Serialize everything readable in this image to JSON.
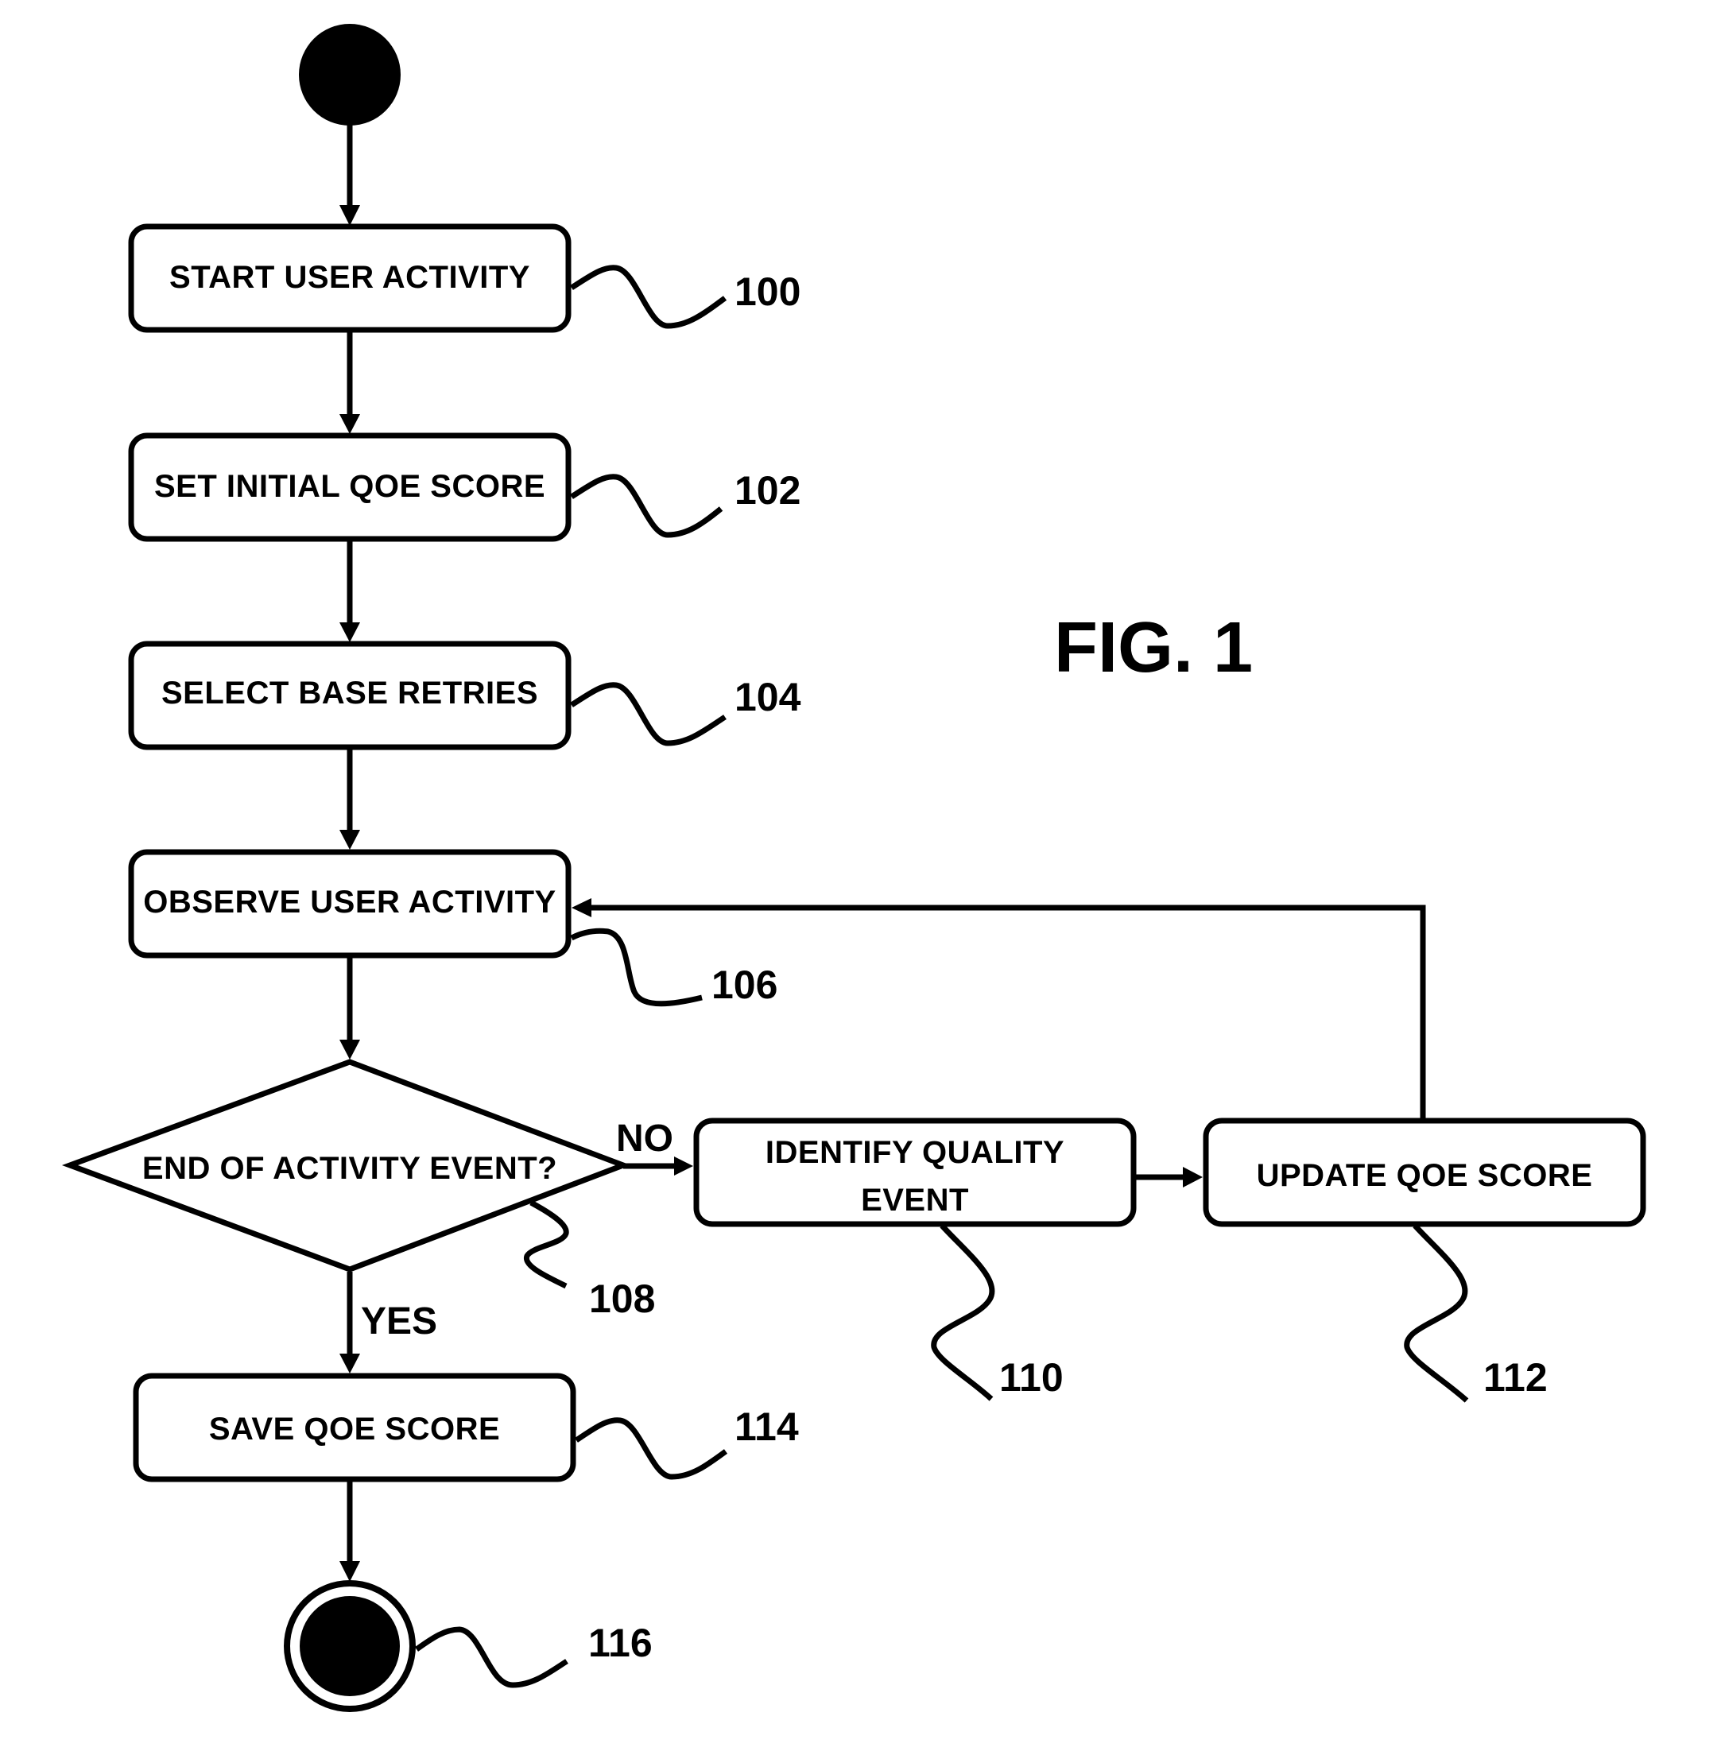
{
  "figure": {
    "title": "FIG. 1"
  },
  "nodes": {
    "start": {
      "type": "initial-node"
    },
    "start_user_activity": {
      "label": "START USER ACTIVITY",
      "ref": "100"
    },
    "set_initial_qoe_score": {
      "label": "SET INITIAL QOE SCORE",
      "ref": "102"
    },
    "select_base_retries": {
      "label": "SELECT BASE RETRIES",
      "ref": "104"
    },
    "observe_user_activity": {
      "label": "OBSERVE USER ACTIVITY",
      "ref": "106"
    },
    "end_of_activity_event": {
      "label": "END OF ACTIVITY EVENT?",
      "ref": "108"
    },
    "identify_quality_event": {
      "label_line1": "IDENTIFY QUALITY",
      "label_line2": "EVENT",
      "ref": "110"
    },
    "update_qoe_score": {
      "label": "UPDATE QOE SCORE",
      "ref": "112"
    },
    "save_qoe_score": {
      "label": "SAVE QOE SCORE",
      "ref": "114"
    },
    "end": {
      "type": "final-node",
      "ref": "116"
    }
  },
  "edges": {
    "no_label": "NO",
    "yes_label": "YES"
  },
  "flow": [
    "start -> START USER ACTIVITY",
    "START USER ACTIVITY -> SET INITIAL QOE SCORE",
    "SET INITIAL QOE SCORE -> SELECT BASE RETRIES",
    "SELECT BASE RETRIES -> OBSERVE USER ACTIVITY",
    "OBSERVE USER ACTIVITY -> END OF ACTIVITY EVENT?",
    "END OF ACTIVITY EVENT? (NO) -> IDENTIFY QUALITY EVENT",
    "IDENTIFY QUALITY EVENT -> UPDATE QOE SCORE",
    "UPDATE QOE SCORE -> OBSERVE USER ACTIVITY",
    "END OF ACTIVITY EVENT? (YES) -> SAVE QOE SCORE",
    "SAVE QOE SCORE -> end"
  ]
}
